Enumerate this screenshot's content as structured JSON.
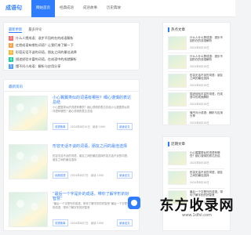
{
  "site": {
    "logo": "成语句",
    "nav": [
      "网站首页",
      "经典成语",
      "成语故事",
      "历史典故"
    ]
  },
  "top_card": {
    "tabs": [
      "最新更新",
      "最多评论"
    ],
    "items": [
      {
        "n": "1",
        "color": "#ff6b6b",
        "text": "什么人攒成语：退步不回的在的成语解析"
      },
      {
        "n": "2",
        "color": "#ff9f43",
        "text": "红把成语有哪些词语？让我们来了解一下"
      },
      {
        "n": "3",
        "color": "#f6b93b",
        "text": "形容无话不谈的词语，朋友之间的最佳选择"
      },
      {
        "n": "4",
        "color": "#1dd1a1",
        "text": "描述经验丰富的词语，在成语中的成就解析"
      },
      {
        "n": "5",
        "color": "#54a0ff",
        "text": "懂不问小成语：解析与应用分享"
      }
    ]
  },
  "main_list": {
    "title": "最新资讯",
    "articles": [
      {
        "title": "小心翼翼类似的词语有哪些？细心谨慎的表达总结",
        "summary": "小心翼翼类似的词语有哪些？细心谨慎的表达总结小心翼翼类似的词语有哪些？细心谨慎的表达总结",
        "tag": "成语故事",
        "date": "2024年8月10日",
        "views": "阅读 1000",
        "more": "阅读全文"
      },
      {
        "title": "形容无话不谈的词语，朋友之间的最佳选择",
        "summary": "形容无话不谈的词语，朋友之间的最佳选择形容无话不谈的词语，朋友之间的最佳选择",
        "tag": "经典成语",
        "date": "2024年8月7日",
        "views": "阅读 1000",
        "more": "阅读全文"
      },
      {
        "title": "“最后一个字是外的成语，带你了解字形的好智慧”",
        "summary": "“最后一个字是外的成语，带你了解字形的好智慧”最后一个字是外的成语，带你了解字形的好智慧",
        "tag": "成语故事",
        "date": "2024年8月7日",
        "views": "阅读 1000",
        "more": "阅读全文"
      }
    ]
  },
  "sidebar": {
    "hot_title": "热点文章",
    "hot": [
      {
        "text": "什么人什么攒成语：退步不回的在的成语解析",
        "date": "2024年8月10日"
      },
      {
        "text": "什么人什么攒成语：退步不回的在的成语解析",
        "date": "2024年8月10日"
      },
      {
        "text": "形容无话不谈的词语：朋友之间的最佳选择",
        "date": "2024年8月10日"
      },
      {
        "text": "描述经验丰富的词语，在成语中的成就解析",
        "date": "2024年8月10日"
      },
      {
        "text": "懂不问小成语：解析与应用分享",
        "date": "2024年8月10日"
      }
    ],
    "recent_title": "近期文章",
    "recent": [
      {
        "text": "小心翼翼类似的词语有哪些？细心谨慎的表达总结",
        "date": "2024年8月10日"
      },
      {
        "text": "形容无话不谈的词语，朋友之间的最佳选择",
        "date": "2024年8月10日"
      },
      {
        "text": "最后一个字是外的成语，带你了解字形的好智慧",
        "date": "2024年8月10日"
      }
    ]
  },
  "watermark": {
    "main": "东方收录网",
    "url": "www.1dfsl.com"
  }
}
